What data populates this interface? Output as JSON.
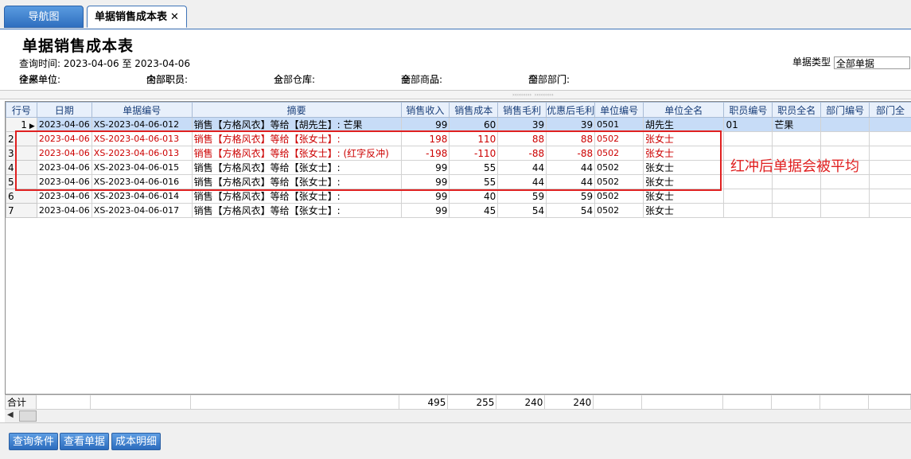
{
  "tabs": [
    {
      "label": "导航图"
    },
    {
      "label": "单据销售成本表",
      "close": "✕"
    }
  ],
  "report": {
    "title": "单据销售成本表",
    "query_label": "查询时间:",
    "date_from": "2023-04-06",
    "date_sep": "至",
    "date_to": "2023-04-06",
    "bill_type_label": "单据类型",
    "bill_type_value": "全部单据"
  },
  "filters": [
    {
      "label": "往来单位:",
      "value": "全部单位"
    },
    {
      "label": "内部职员:",
      "value": "全部职员"
    },
    {
      "label": "仓　　库:",
      "value": "全部仓库"
    },
    {
      "label": "商　　品:",
      "value": "全部商品"
    },
    {
      "label": "部　　门:",
      "value": "全部部门"
    }
  ],
  "columns": [
    "行号",
    "日期",
    "单据编号",
    "摘要",
    "销售收入",
    "销售成本",
    "销售毛利",
    "优惠后毛利",
    "单位编号",
    "单位全名",
    "职员编号",
    "职员全名",
    "部门编号",
    "部门全"
  ],
  "rows": [
    {
      "no": "1",
      "date": "2023-04-06",
      "code": "XS-2023-04-06-012",
      "summary": "销售【方格风衣】等给【胡先生】: 芒果",
      "income": "99",
      "cost": "60",
      "profit": "39",
      "net": "39",
      "ucode": "0501",
      "uname": "胡先生",
      "ecode": "01",
      "ename": "芒果",
      "dcode": "",
      "dname": "",
      "style": "sel"
    },
    {
      "no": "2",
      "date": "2023-04-06",
      "code": "XS-2023-04-06-013",
      "summary": "销售【方格风衣】等给【张女士】:",
      "income": "198",
      "cost": "110",
      "profit": "88",
      "net": "88",
      "ucode": "0502",
      "uname": "张女士",
      "ecode": "",
      "ename": "",
      "dcode": "",
      "dname": "",
      "style": "red"
    },
    {
      "no": "3",
      "date": "2023-04-06",
      "code": "XS-2023-04-06-013",
      "summary": "销售【方格风衣】等给【张女士】: (红字反冲)",
      "income": "-198",
      "cost": "-110",
      "profit": "-88",
      "net": "-88",
      "ucode": "0502",
      "uname": "张女士",
      "ecode": "",
      "ename": "",
      "dcode": "",
      "dname": "",
      "style": "red"
    },
    {
      "no": "4",
      "date": "2023-04-06",
      "code": "XS-2023-04-06-015",
      "summary": "销售【方格风衣】等给【张女士】:",
      "income": "99",
      "cost": "55",
      "profit": "44",
      "net": "44",
      "ucode": "0502",
      "uname": "张女士",
      "ecode": "",
      "ename": "",
      "dcode": "",
      "dname": "",
      "style": ""
    },
    {
      "no": "5",
      "date": "2023-04-06",
      "code": "XS-2023-04-06-016",
      "summary": "销售【方格风衣】等给【张女士】:",
      "income": "99",
      "cost": "55",
      "profit": "44",
      "net": "44",
      "ucode": "0502",
      "uname": "张女士",
      "ecode": "",
      "ename": "",
      "dcode": "",
      "dname": "",
      "style": ""
    },
    {
      "no": "6",
      "date": "2023-04-06",
      "code": "XS-2023-04-06-014",
      "summary": "销售【方格风衣】等给【张女士】:",
      "income": "99",
      "cost": "40",
      "profit": "59",
      "net": "59",
      "ucode": "0502",
      "uname": "张女士",
      "ecode": "",
      "ename": "",
      "dcode": "",
      "dname": "",
      "style": ""
    },
    {
      "no": "7",
      "date": "2023-04-06",
      "code": "XS-2023-04-06-017",
      "summary": "销售【方格风衣】等给【张女士】:",
      "income": "99",
      "cost": "45",
      "profit": "54",
      "net": "54",
      "ucode": "0502",
      "uname": "张女士",
      "ecode": "",
      "ename": "",
      "dcode": "",
      "dname": "",
      "style": ""
    }
  ],
  "totals": {
    "label": "合计",
    "income": "495",
    "cost": "255",
    "profit": "240",
    "net": "240"
  },
  "buttons": {
    "query": "查询条件",
    "view": "查看单据",
    "detail": "成本明细"
  },
  "annotation": {
    "text": "红冲后单据会被平均",
    "color": "#e02020"
  },
  "colors": {
    "tab_active_border": "#3f74b8",
    "button_blue": "#2c6cbd",
    "selected_row": "#c7dcf7",
    "red_text": "#cc0000"
  }
}
